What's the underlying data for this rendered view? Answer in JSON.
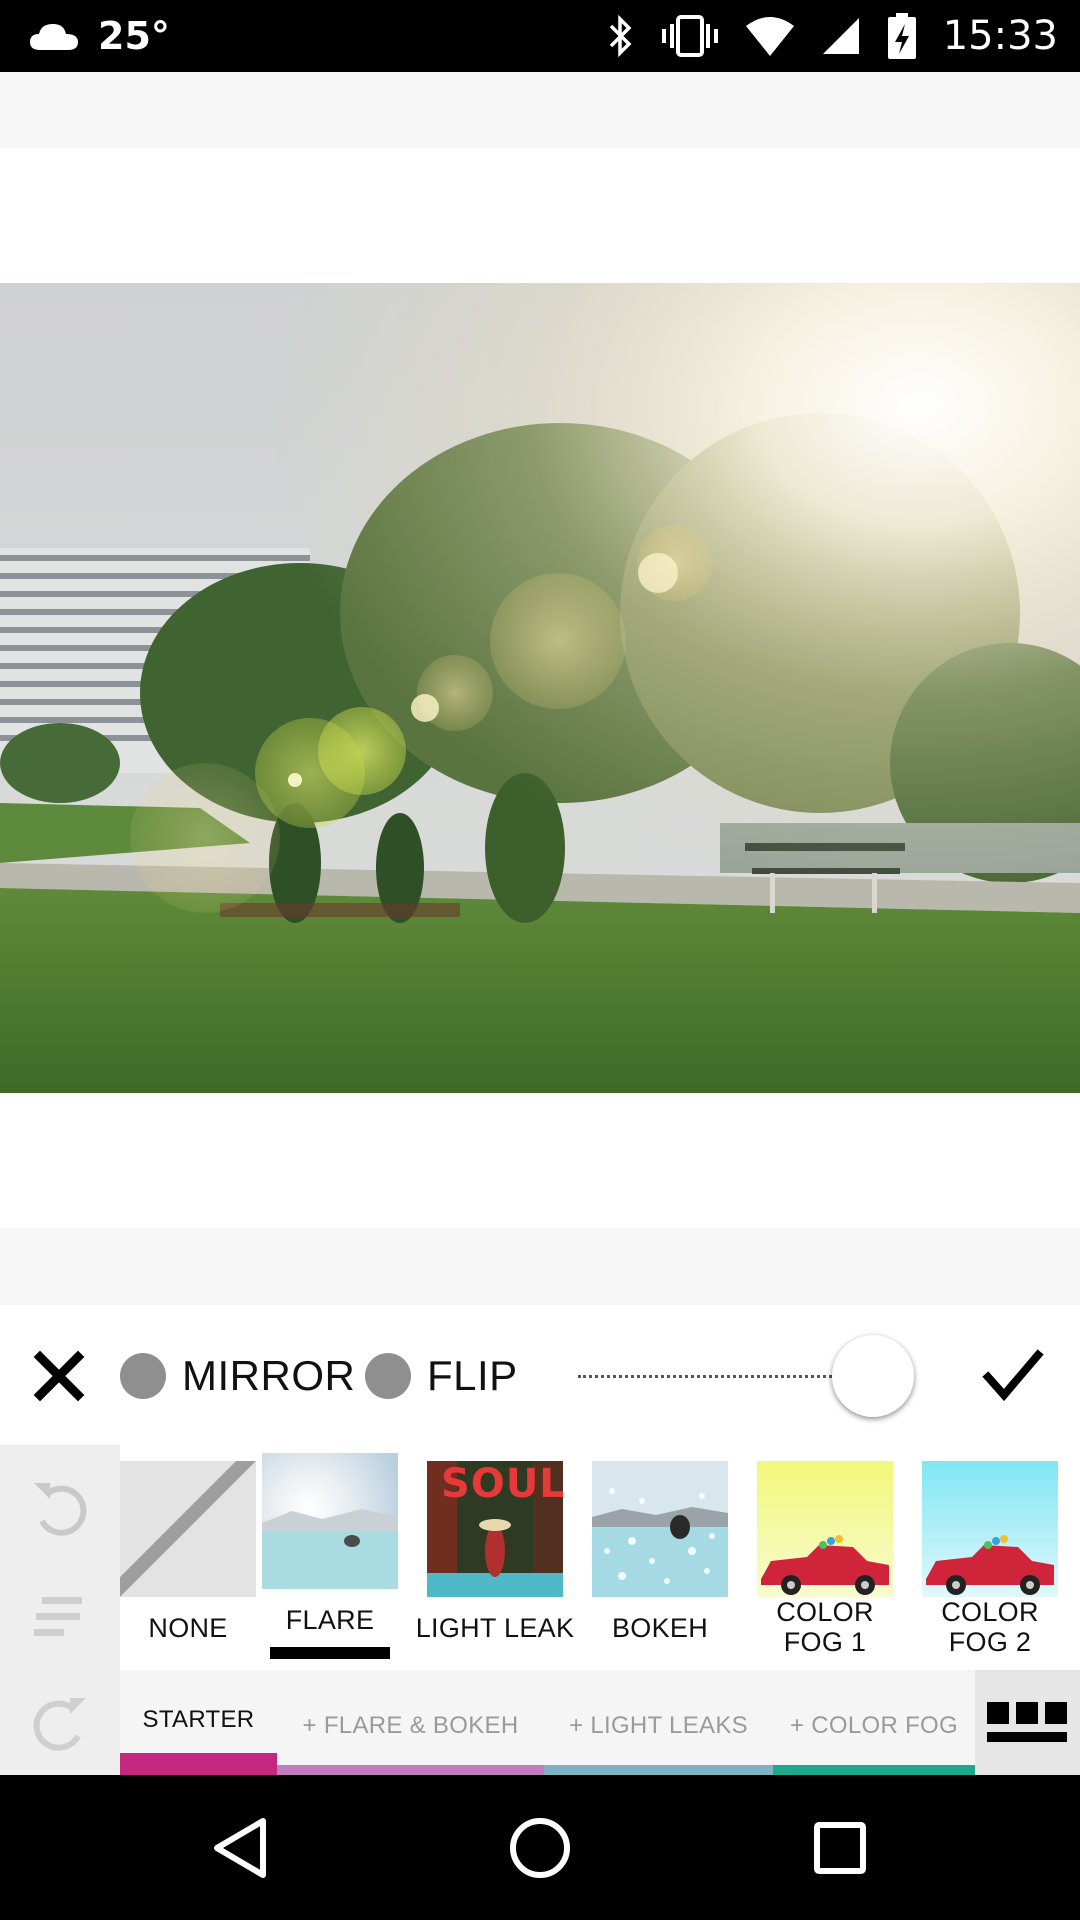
{
  "status_bar": {
    "temperature": "25°",
    "time": "15:33",
    "icons": [
      "cloud-icon",
      "bluetooth-icon",
      "vibrate-icon",
      "wifi-icon",
      "signal-icon",
      "battery-charging-icon"
    ]
  },
  "editor": {
    "close_icon": "close-icon",
    "mirror_label": "MIRROR",
    "flip_label": "FLIP",
    "intensity_level": 0.9,
    "confirm_icon": "checkmark-icon"
  },
  "side_tools": [
    "undo-icon",
    "adjust-icon",
    "redo-icon"
  ],
  "filters": [
    {
      "label": "NONE",
      "selected": false
    },
    {
      "label": "FLARE",
      "selected": true
    },
    {
      "label": "LIGHT LEAK",
      "thumb_text": "SOUL",
      "selected": false
    },
    {
      "label": "BOKEH",
      "selected": false
    },
    {
      "label": "COLOR FOG 1",
      "selected": false
    },
    {
      "label": "COLOR FOG 2",
      "selected": false
    }
  ],
  "tabs": [
    {
      "label": "STARTER",
      "color": "#c5267f",
      "active": true
    },
    {
      "label": "+ FLARE & BOKEH",
      "color": "#c27cc0",
      "active": false
    },
    {
      "label": "+ LIGHT LEAKS",
      "color": "#7fb2c4",
      "active": false
    },
    {
      "label": "+ COLOR FOG",
      "color": "#1ca98c",
      "active": false
    }
  ],
  "grid_icon": "grid-view-icon",
  "nav": [
    "back-icon",
    "home-icon",
    "recents-icon"
  ]
}
